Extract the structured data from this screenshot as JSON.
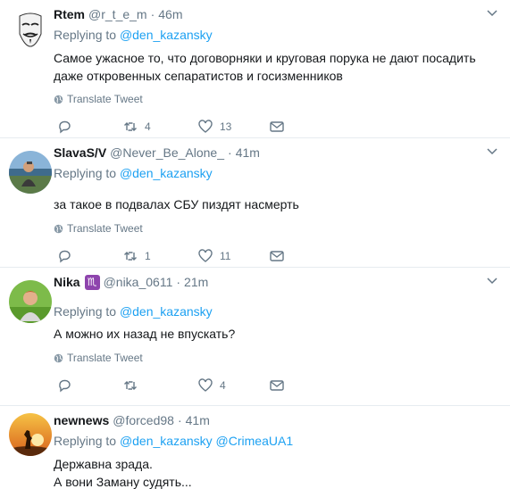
{
  "tweets": [
    {
      "name": "Rtem",
      "handle": "@r_t_e_m",
      "separator": "·",
      "time": "46m",
      "replying_prefix": "Replying to",
      "replying_to": "@den_kazansky",
      "replying_to_2": "",
      "text_lines": [
        "Самое ужасное то, что договорняки и круговая порука не дают посадить",
        "даже откровенных сепаратистов и госизменников"
      ],
      "translate": "Translate Tweet",
      "reply_count": "",
      "retweet_count": "4",
      "like_count": "13",
      "avatar_icon": "guy-fawkes-mask-avatar"
    },
    {
      "name": "SlavaS/V",
      "handle": "@Never_Be_Alone_",
      "separator": "·",
      "time": "41m",
      "replying_prefix": "Replying to",
      "replying_to": "@den_kazansky",
      "replying_to_2": "",
      "text_lines": [
        "за такое в подвалах СБУ пиздят насмерть"
      ],
      "translate": "Translate Tweet",
      "reply_count": "",
      "retweet_count": "1",
      "like_count": "11",
      "avatar_icon": "person-outdoor-avatar"
    },
    {
      "name": "Nika",
      "badge": "♏",
      "handle": "@nika_0611",
      "separator": "·",
      "time": "21m",
      "replying_prefix": "Replying to",
      "replying_to": "@den_kazansky",
      "replying_to_2": "",
      "text_lines": [
        "А можно их назад не впускать?"
      ],
      "translate": "Translate Tweet",
      "reply_count": "",
      "retweet_count": "",
      "like_count": "4",
      "avatar_icon": "person-green-avatar"
    },
    {
      "name": "newnews",
      "handle": "@forced98",
      "separator": "·",
      "time": "41m",
      "replying_prefix": "Replying to",
      "replying_to": "@den_kazansky",
      "replying_to_2": "@CrimeaUA1",
      "text_lines": [
        "Державна зрада.",
        "А вони Заману судять..."
      ],
      "translate": "",
      "reply_count": "",
      "retweet_count": "",
      "like_count": "",
      "avatar_icon": "sunset-silhouette-avatar"
    }
  ],
  "colors": {
    "link": "#1da1f2",
    "secondary": "#657786",
    "text": "#14171a",
    "divider": "#e6ecf0"
  }
}
